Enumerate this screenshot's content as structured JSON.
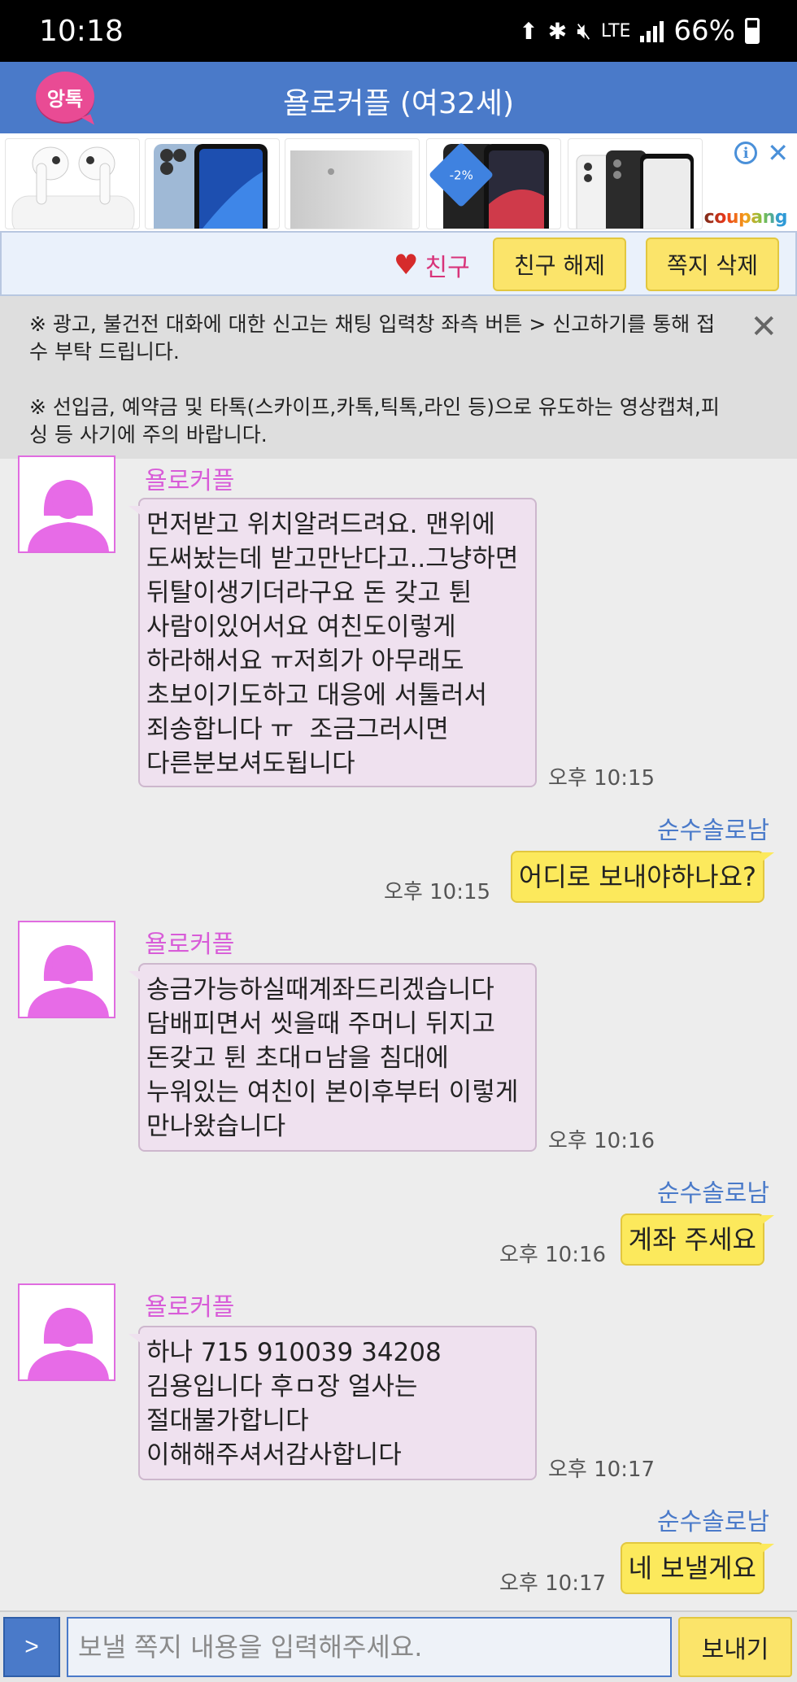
{
  "status_bar": {
    "time": "10:18",
    "network": "LTE",
    "battery": "66%"
  },
  "header": {
    "logo_text": "앙톡",
    "title": "욜로커플 (여32세)"
  },
  "ad": {
    "discount": "-2%",
    "brand": "coupang"
  },
  "actions": {
    "friend_label": "친구",
    "unfriend_label": "친구 해제",
    "delete_label": "쪽지 삭제"
  },
  "notice": {
    "line1": "※ 광고, 불건전 대화에 대한 신고는 채팅 입력창 좌측 버튼 > 신고하기를 통해 접수 부탁 드립니다.",
    "line2": "※ 선입금, 예약금 및 타톡(스카이프,카톡,틱톡,라인 등)으로 유도하는 영상캡쳐,피싱 등 사기에 주의 바랍니다."
  },
  "messages": [
    {
      "from": "other",
      "sender": "욜로커플",
      "text": "먼저받고 위치알려드려요. 맨위에 도써놨는데 받고만난다고..그냥하면 뒤탈이생기더라구요 돈 갖고 튄 사람이있어서요 여친도이렇게 하라해서요 ㅠ저희가 아무래도 초보이기도하고 대응에 서툴러서 죄송합니다 ㅠ  조금그러시면 다른분보셔도됩니다",
      "time": "오후 10:15"
    },
    {
      "from": "me",
      "sender": "순수솔로남",
      "text": "어디로 보내야하나요?",
      "time": "오후 10:15"
    },
    {
      "from": "other",
      "sender": "욜로커플",
      "text": "송금가능하실때계좌드리겠습니다 담배피면서 씻을때 주머니 뒤지고  돈갖고 튄 초대ㅁ남을 침대에 누워있는 여친이 본이후부터 이렇게 만나왔습니다",
      "time": "오후 10:16"
    },
    {
      "from": "me",
      "sender": "순수솔로남",
      "text": "계좌 주세요",
      "time": "오후 10:16"
    },
    {
      "from": "other",
      "sender": "욜로커플",
      "text": "하나 715 910039 34208\n김용입니다 후ㅁ장 얼사는\n절대불가합니다\n이해해주셔서감사합니다",
      "time": "오후 10:17"
    },
    {
      "from": "me",
      "sender": "순수솔로남",
      "text": "네 보낼게요",
      "time": "오후 10:17"
    }
  ],
  "input": {
    "menu_label": ">",
    "placeholder": "보낼 쪽지 내용을 입력해주세요.",
    "send_label": "보내기"
  },
  "colors": {
    "header": "#4a7ac9",
    "in_bubble": "#efe1ef",
    "out_bubble": "#fce95c",
    "sender_other": "#d85cd8",
    "sender_me": "#4a7ac9"
  }
}
